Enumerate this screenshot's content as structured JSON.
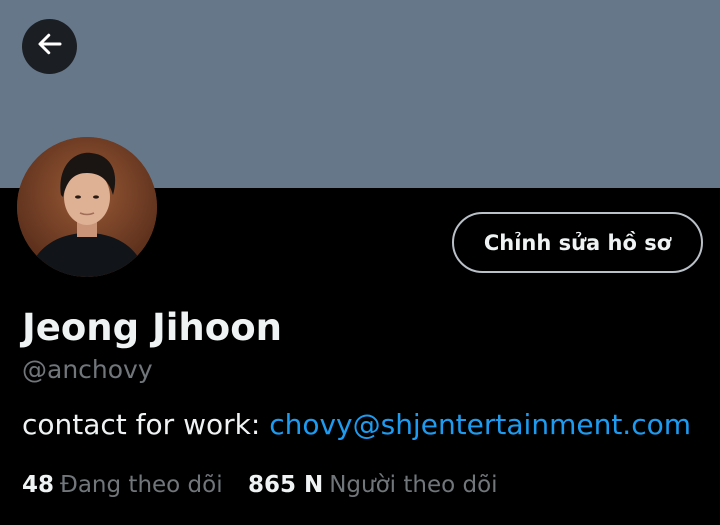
{
  "profile": {
    "display_name": "Jeong Jihoon",
    "handle": "@anchovy",
    "edit_button_label": "Chỉnh sửa hồ sơ",
    "bio_prefix": "contact for work:",
    "bio_link": "chovy@shjentertainment.com"
  },
  "stats": {
    "following_count": "48",
    "following_label": "Đang theo dõi",
    "followers_count": "865 N",
    "followers_label": "Người theo dõi"
  },
  "icons": {
    "back": "arrow-left-icon"
  },
  "colors": {
    "banner": "#66778a",
    "background": "#000000",
    "link": "#1d9bf0",
    "secondary_text": "#71767b"
  }
}
